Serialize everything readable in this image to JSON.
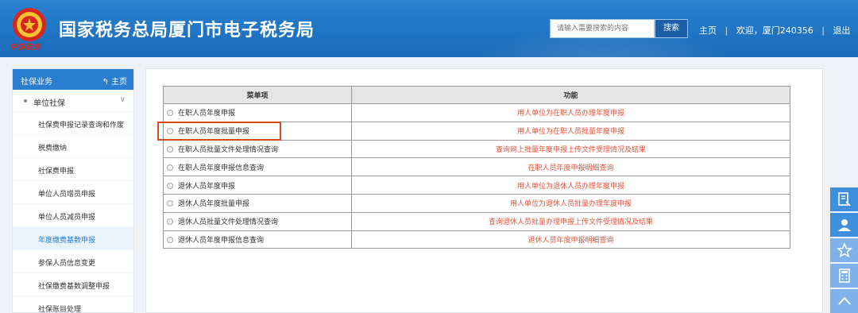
{
  "header": {
    "logo_text": "中国税务",
    "site_title": "国家税务总局厦门市电子税务局",
    "search": {
      "placeholder": "请输入需要搜索的内容",
      "button_label": "搜索"
    },
    "nav": {
      "home": "主页",
      "welcome": "欢迎，厦门240356",
      "logout": "退出",
      "separator": "|"
    }
  },
  "sidebar": {
    "header": {
      "title": "社保业务",
      "home_label": "主页"
    },
    "group": {
      "label": "单位社保"
    },
    "items": [
      {
        "label": "社保费申报记录查询和作废"
      },
      {
        "label": "税费缴纳"
      },
      {
        "label": "社保费申报"
      },
      {
        "label": "单位人员增员申报"
      },
      {
        "label": "单位人员减员申报"
      },
      {
        "label": "年度缴费基数申报",
        "active": true
      },
      {
        "label": "参保人员信息变更"
      },
      {
        "label": "社保缴费基数调整申报"
      },
      {
        "label": "社保账目处理"
      }
    ]
  },
  "table": {
    "headers": [
      "菜单项",
      "功能"
    ],
    "rows": [
      {
        "menu": "在职人员年度申报",
        "function": "用人单位为在职人员办理年度申报"
      },
      {
        "menu": "在职人员年度批量申报",
        "function": "用人单位为在职人员批量年度申报"
      },
      {
        "menu": "在职人员批量文件处理情况查询",
        "function": "查询网上批量年度申报上传文件受理情况及结果"
      },
      {
        "menu": "在职人员年度申报信息查询",
        "function": "在职人员年度申报明细查询"
      },
      {
        "menu": "退休人员年度申报",
        "function": "用人单位为退休人员办理年度申报"
      },
      {
        "menu": "退休人员年度批量申报",
        "function": "用人单位为退休人员批量办理年度申报"
      },
      {
        "menu": "退休人员批量文件处理情况查询",
        "function": "查询退休人员批量办理申报上传文件受理情况及结果"
      },
      {
        "menu": "退休人员年度申报信息查询",
        "function": "退休人员年度申报明细查询"
      }
    ]
  },
  "floatbar": [
    "report-icon",
    "user-icon",
    "star-icon",
    "calculator-icon",
    "chevron-up-icon"
  ],
  "colors": {
    "header_blue": "#1f73c2",
    "function_red": "#e8513a",
    "highlight_orange": "#d44a1f"
  }
}
